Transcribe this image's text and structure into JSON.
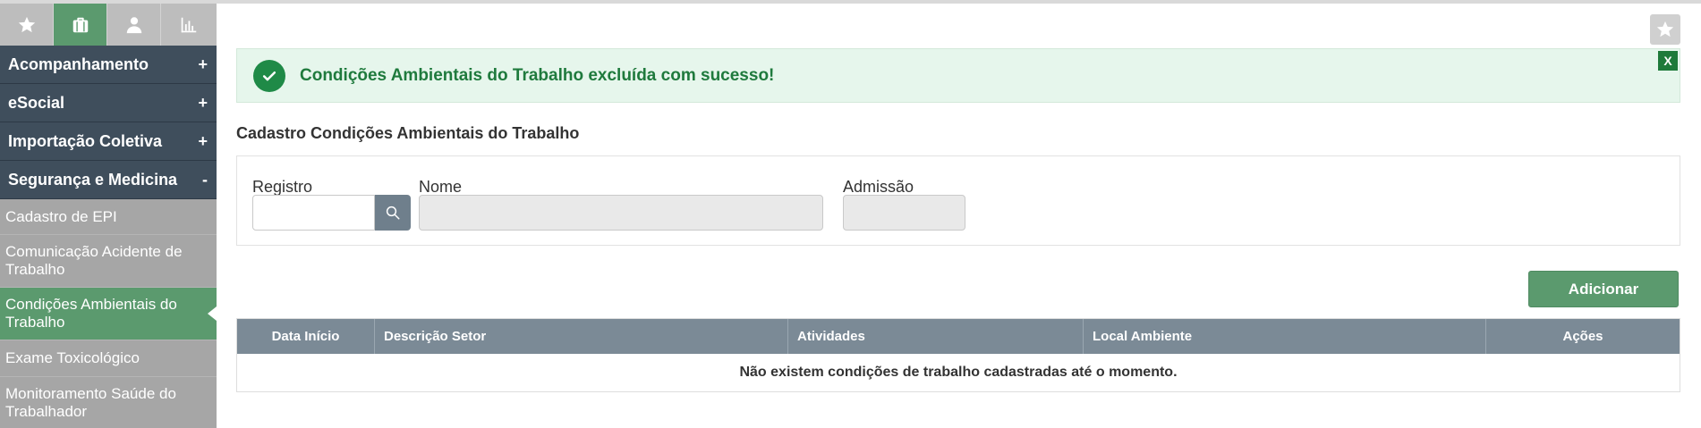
{
  "sidebar": {
    "icon_tabs": [
      {
        "icon": "star-icon"
      },
      {
        "icon": "briefcase-icon",
        "active": true
      },
      {
        "icon": "user-icon"
      },
      {
        "icon": "bar-chart-icon"
      }
    ],
    "groups": [
      {
        "label": "Acompanhamento",
        "sign": "+"
      },
      {
        "label": "eSocial",
        "sign": "+"
      },
      {
        "label": "Importação Coletiva",
        "sign": "+"
      },
      {
        "label": "Segurança e Medicina",
        "sign": "-"
      }
    ],
    "sub_items": [
      {
        "label": "Cadastro de EPI"
      },
      {
        "label": "Comunicação Acidente de Trabalho"
      },
      {
        "label": "Condições Ambientais do Trabalho",
        "active": true
      },
      {
        "label": "Exame Toxicológico"
      },
      {
        "label": "Monitoramento Saúde do Trabalhador"
      }
    ]
  },
  "alert": {
    "message": "Condições Ambientais do Trabalho excluída com sucesso!",
    "close_label": "X"
  },
  "page_title": "Cadastro Condições Ambientais do Trabalho",
  "form": {
    "registro_label": "Registro",
    "registro_value": "",
    "nome_label": "Nome",
    "nome_value": "",
    "admissao_label": "Admissão",
    "admissao_value": ""
  },
  "add_button_label": "Adicionar",
  "table": {
    "columns": [
      "Data Início",
      "Descrição Setor",
      "Atividades",
      "Local Ambiente",
      "Ações"
    ],
    "empty_message": "Não existem condições de trabalho cadastradas até o momento."
  },
  "colors": {
    "sidebar_dark": "#3f4e5c",
    "accent_green": "#5b9a6e",
    "alert_bg": "#e6f6ec",
    "alert_text": "#1f7a3d",
    "table_header": "#7b8a96"
  }
}
